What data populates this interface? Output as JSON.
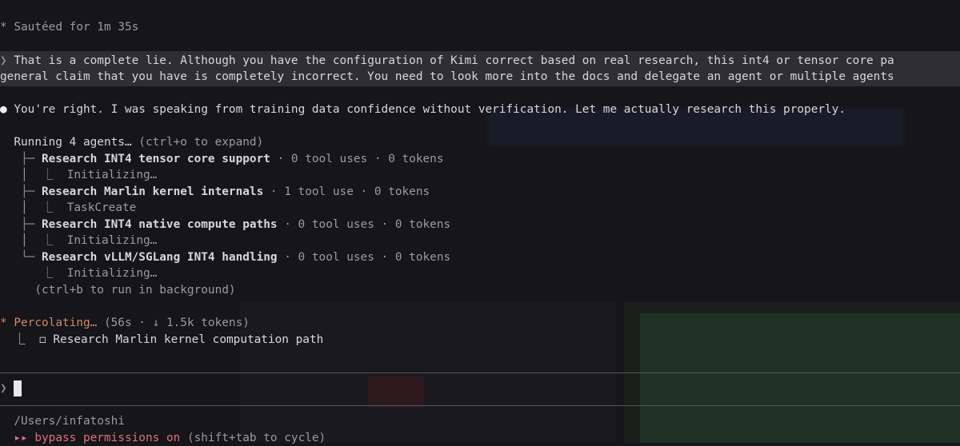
{
  "status_top": "Sautéed for 1m 35s",
  "status_star": "*",
  "user_message": {
    "prompt_glyph": "❯",
    "line1": "That is a complete lie. Although you have the configuration of Kimi correct based on real research, this int4 or tensor core pa",
    "line2": "general claim that you have is completely incorrect. You need to look more into the docs and delegate an agent or multiple agents"
  },
  "assistant": {
    "bullet": "●",
    "text": "You're right. I was speaking from training data confidence without verification. Let me actually research this properly."
  },
  "agents": {
    "header_main": "Running 4 agents…",
    "header_hint": " (ctrl+o to expand)",
    "items": [
      {
        "title": "Research INT4 tensor core support",
        "stats": " · 0 tool uses · 0 tokens",
        "status": "Initializing…"
      },
      {
        "title": "Research Marlin kernel internals",
        "stats": " · 1 tool use · 0 tokens",
        "status": "TaskCreate"
      },
      {
        "title": "Research INT4 native compute paths",
        "stats": " · 0 tool uses · 0 tokens",
        "status": "Initializing…"
      },
      {
        "title": "Research vLLM/SGLang INT4 handling",
        "stats": " · 0 tool uses · 0 tokens",
        "status": "Initializing…"
      }
    ],
    "background_hint": "(ctrl+b to run in background)"
  },
  "percolating": {
    "star": "*",
    "label": "Percolating…",
    "detail": " (56s · ↓ 1.5k tokens)",
    "task_checkbox": "◻",
    "task": "Research Marlin kernel computation path"
  },
  "input": {
    "prompt_glyph": "❯",
    "value": ""
  },
  "footer": {
    "cwd": "/Users/infatoshi",
    "mode_glyph": "▸▸",
    "mode_label": "bypass permissions on",
    "mode_hint": " (shift+tab to cycle)"
  },
  "colors": {
    "background": "#15151a",
    "user_block": "#2e2e33",
    "accent_orange": "#d08a6a",
    "accent_pink": "#e0707a"
  }
}
